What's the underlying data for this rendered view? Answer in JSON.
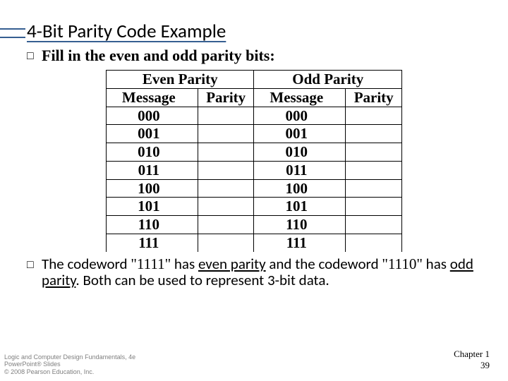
{
  "title": "4-Bit Parity Code Example",
  "bullet1": "Fill in the even and odd parity bits:",
  "table": {
    "even_head": "Even Parity",
    "odd_head": "Odd Parity",
    "msg_label": "Message",
    "parity_label": "Parity",
    "rows": [
      "000",
      "001",
      "010",
      "011",
      "100",
      "101",
      "110",
      "111"
    ]
  },
  "bullet2": {
    "a": "The codeword ",
    "q1": "\"1111\"",
    "b": " has ",
    "evenp": "even parity",
    "c": " and the codeword ",
    "q2": "\"1110\"",
    "d": " has ",
    "oddp": "odd parity",
    "e": ".   Both can be used to represent 3-bit data."
  },
  "footer_left": {
    "l1": "Logic and Computer Design Fundamentals, 4e",
    "l2": "PowerPoint® Slides",
    "l3": "© 2008 Pearson Education, Inc."
  },
  "footer_right": {
    "l1": "Chapter 1",
    "l2": "39"
  }
}
